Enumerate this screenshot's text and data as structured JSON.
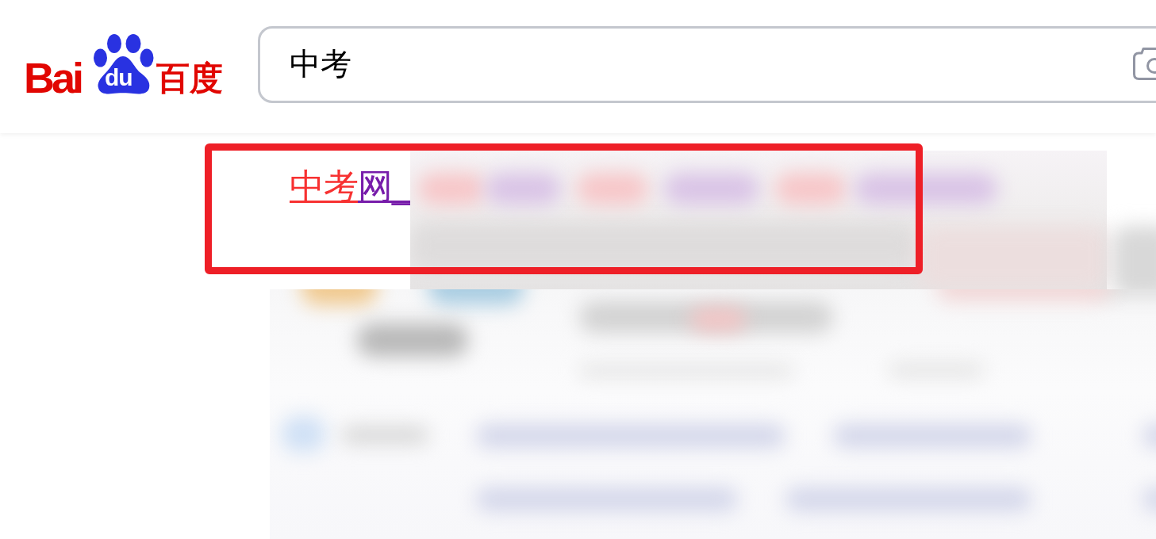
{
  "logo": {
    "text_left": "Bai",
    "paw_text": "du",
    "text_right": "百度"
  },
  "search": {
    "value": "中考"
  },
  "results": [
    {
      "title_parts": [
        {
          "text": "中考",
          "highlight": true
        },
        {
          "text": "网_",
          "highlight": false
        }
      ],
      "visited": true
    }
  ],
  "annotations": [
    {
      "kind": "frame"
    }
  ]
}
